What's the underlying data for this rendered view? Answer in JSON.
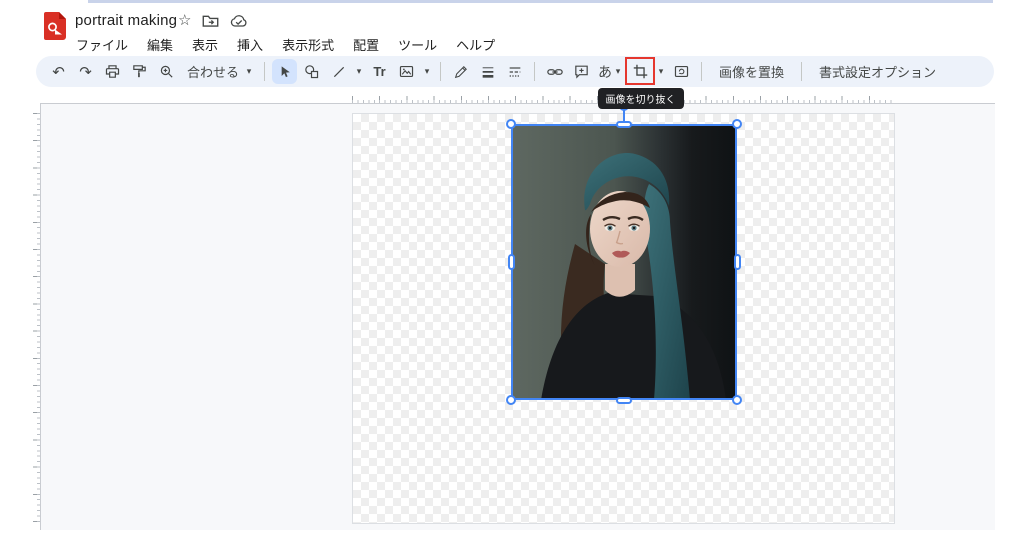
{
  "header": {
    "app": "Google Drawings",
    "title": "portrait making",
    "menus": [
      "ファイル",
      "編集",
      "表示",
      "挿入",
      "表示形式",
      "配置",
      "ツール",
      "ヘルプ"
    ]
  },
  "toolbar": {
    "fit_label": "合わせる",
    "replace_image_label": "画像を置換",
    "format_options_label": "書式設定オプション"
  },
  "tooltip": {
    "crop_text": "画像を切り抜く"
  },
  "glyphs": {
    "undo": "↶",
    "redo": "↷",
    "caret": "▾",
    "star": "☆",
    "text_tool": "あ",
    "text_format": "Tr"
  },
  "canvas": {
    "selected_object": "portrait photo of woman with teal headscarf",
    "background": "transparent checkerboard"
  },
  "colors": {
    "selection_blue": "#4285f4",
    "annotation_red": "#e5372e",
    "toolbar_bg": "#edf2fa",
    "active_tool_bg": "#d3e3fd",
    "tooltip_bg": "#202124",
    "logo_red": "#d93025"
  }
}
